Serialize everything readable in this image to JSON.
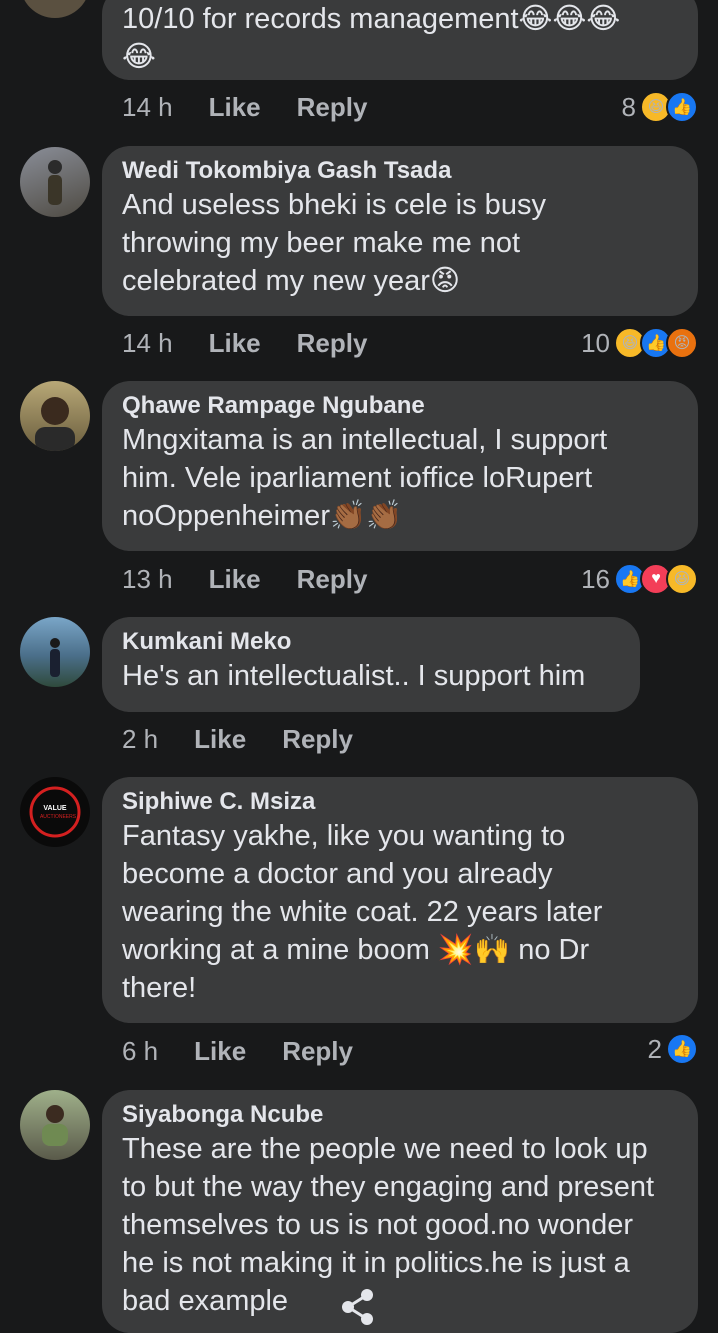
{
  "comments": [
    {
      "name": "",
      "text": "10/10 for records management😂😂😂\n😂",
      "time": "14 h",
      "like": "Like",
      "reply": "Reply",
      "reactions_count": "8",
      "reactions": [
        "haha",
        "like"
      ]
    },
    {
      "name": "Wedi Tokombiya Gash Tsada",
      "text": "And useless bheki is  cele is busy\nthrowing my beer make me not\ncelebrated my new year😡",
      "time": "14 h",
      "like": "Like",
      "reply": "Reply",
      "reactions_count": "10",
      "reactions": [
        "haha",
        "like",
        "angry"
      ]
    },
    {
      "name": "Qhawe Rampage Ngubane",
      "text": "Mngxitama is an intellectual, I support\nhim. Vele iparliament ioffice loRupert\nnoOppenheimer👏🏾👏🏾",
      "time": "13 h",
      "like": "Like",
      "reply": "Reply",
      "reactions_count": "16",
      "reactions": [
        "like",
        "love",
        "haha"
      ]
    },
    {
      "name": "Kumkani Meko",
      "text": "He's an intellectualist.. I support him",
      "time": "2 h",
      "like": "Like",
      "reply": "Reply",
      "reactions_count": "",
      "reactions": []
    },
    {
      "name": "Siphiwe C. Msiza",
      "text": "Fantasy yakhe, like you wanting to\nbecome a doctor and you already\nwearing the white coat.  22 years later\nworking at a mine boom 💥🙌 no Dr\nthere!",
      "time": "6 h",
      "like": "Like",
      "reply": "Reply",
      "reactions_count": "2",
      "reactions": [
        "like"
      ],
      "avatar_text": "VALUE AUCTIONEERS"
    },
    {
      "name": "Siyabonga Ncube",
      "text": "These are the people we need to look up\nto but the way they engaging and present\nthemselves to us is not good.no wonder\nhe is not making it in politics.he is just a\nbad example",
      "time": "",
      "like": "",
      "reply": "",
      "reactions_count": "",
      "reactions": []
    }
  ],
  "colors": {
    "background": "#18191a",
    "bubble": "#3a3b3c",
    "like": "#1877f2",
    "love": "#f33e58",
    "haha": "#f7b928",
    "angry": "#e9710f"
  },
  "icons": {
    "share": "share-icon"
  }
}
